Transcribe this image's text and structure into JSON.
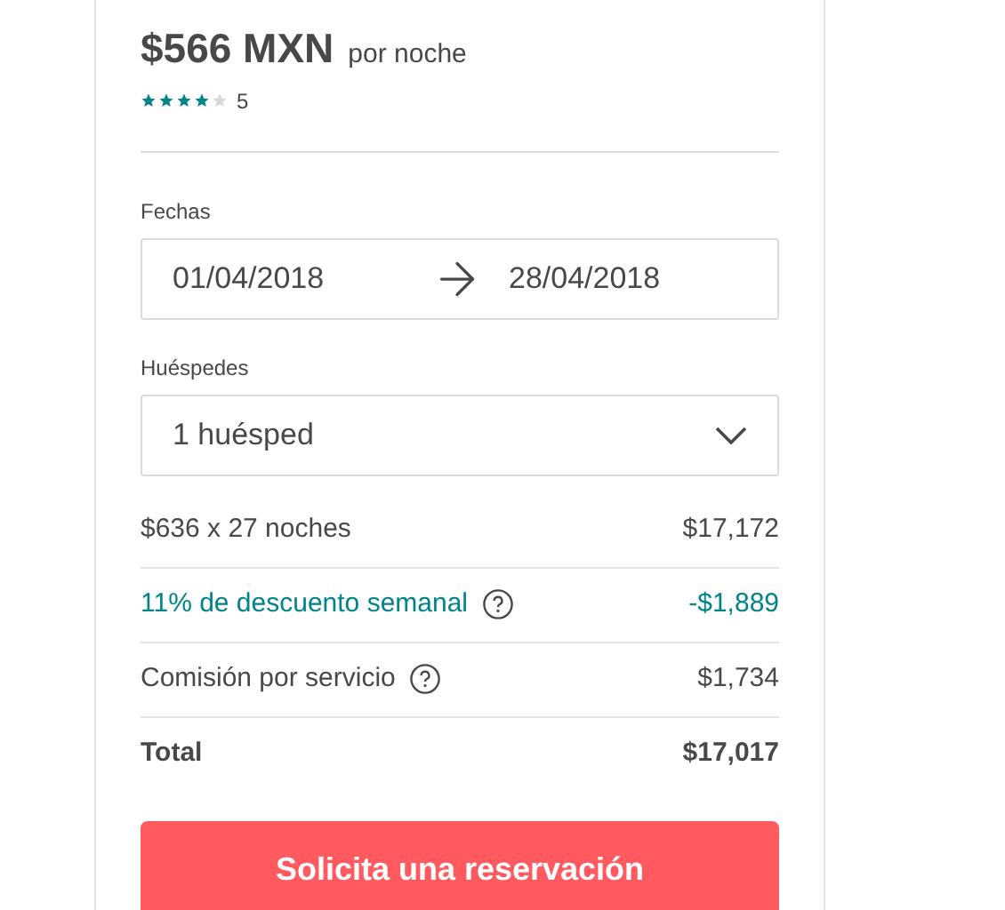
{
  "price": {
    "amount": "$566 MXN",
    "unit": "por noche",
    "stars": 4,
    "reviews": "5"
  },
  "dates": {
    "label": "Fechas",
    "check_in": "01/04/2018",
    "check_out": "28/04/2018"
  },
  "guests": {
    "label": "Huéspedes",
    "value": "1 huésped"
  },
  "lines": [
    {
      "kind": "plain",
      "label": "$636 x 27 noches",
      "amount": "$17,172",
      "info": false
    },
    {
      "kind": "discount",
      "label": "11% de descuento semanal",
      "amount": "-$1,889",
      "info": true
    },
    {
      "kind": "plain",
      "label": "Comisión por servicio",
      "amount": "$1,734",
      "info": true
    },
    {
      "kind": "total",
      "label": "Total",
      "amount": "$17,017",
      "info": false
    }
  ],
  "button": "Solicita una reservación"
}
